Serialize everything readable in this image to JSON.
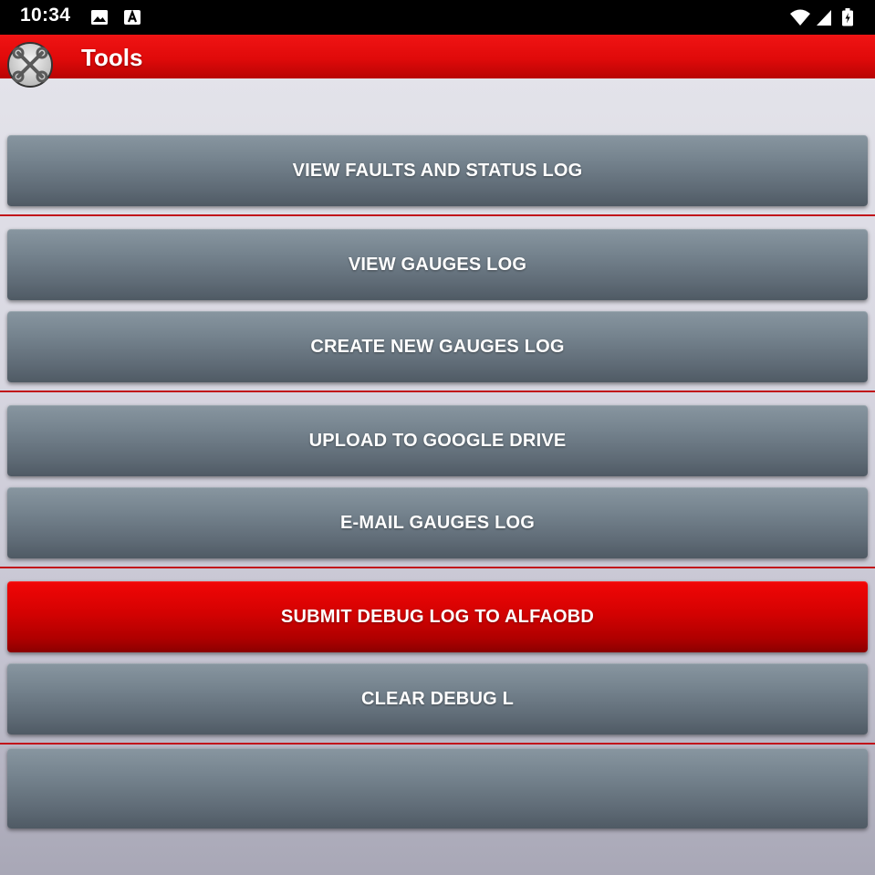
{
  "status_bar": {
    "time": "10:34",
    "icons": [
      "image-notification-icon",
      "a-notification-icon",
      "wifi-icon",
      "signal-icon",
      "battery-icon"
    ]
  },
  "app_bar": {
    "title": "Tools",
    "logo_icon": "crossed-wrenches-logo-icon"
  },
  "buttons": [
    {
      "label": "VIEW FAULTS AND STATUS LOG"
    },
    {
      "label": "VIEW GAUGES LOG"
    },
    {
      "label": "CREATE NEW GAUGES LOG"
    },
    {
      "label": "UPLOAD TO GOOGLE DRIVE"
    },
    {
      "label": "E-MAIL GAUGES LOG"
    },
    {
      "label": "SUBMIT DEBUG LOG TO ALFAOBD"
    },
    {
      "label": "CLEAR DEBUG L"
    },
    {
      "label": ""
    }
  ],
  "colors": {
    "app_bar": "#e00a0a",
    "button": "#6e7b86",
    "accent_button": "#d40202",
    "divider": "#c1141a"
  }
}
